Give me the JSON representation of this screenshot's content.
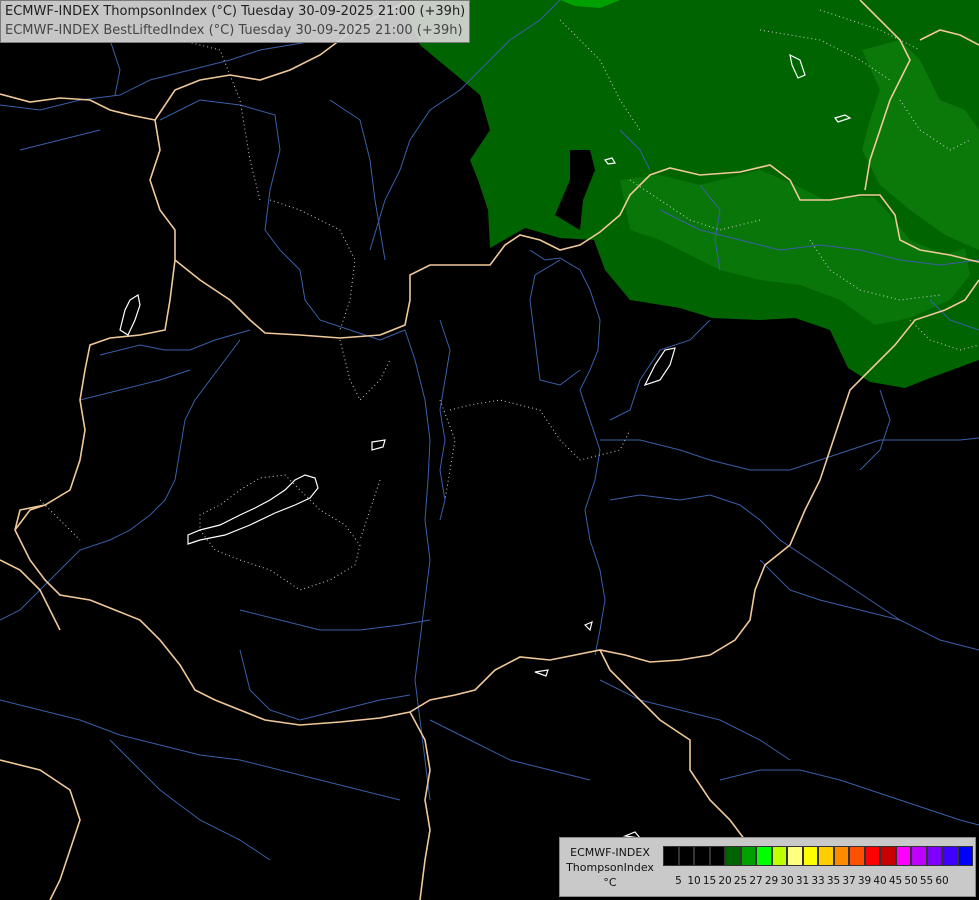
{
  "titles": {
    "line1": "ECMWF-INDEX ThompsonIndex (°C) Tuesday 30-09-2025 21:00 (+39h)",
    "line2": "ECMWF-INDEX BestLiftedIndex (°C) Tuesday 30-09-2025 21:00 (+39h)"
  },
  "legend": {
    "line1": "ECMWF-INDEX",
    "line2": "ThompsonIndex",
    "line3": "°C",
    "colors": [
      "#000000",
      "#000000",
      "#000000",
      "#000000",
      "#006400",
      "#00a000",
      "#00ff00",
      "#c0ff00",
      "#ffff80",
      "#ffff00",
      "#ffcc00",
      "#ff8c00",
      "#ff5000",
      "#ff0000",
      "#c80000",
      "#ff00ff",
      "#c000ff",
      "#8000ff",
      "#4000ff",
      "#0000ff"
    ],
    "ticks": [
      "5",
      "10",
      "15",
      "20",
      "25",
      "27",
      "29",
      "30",
      "31",
      "33",
      "35",
      "37",
      "39",
      "40",
      "45",
      "50",
      "55",
      "60"
    ]
  },
  "map": {
    "field_colors": {
      "background": "#000000",
      "green_area": "#006400",
      "light_green": "#1a8c1a"
    },
    "line_colors": {
      "borders": "#f5cfa0",
      "rivers": "#3b5fa8",
      "contours_dotted": "#d0d0d0",
      "lakes": "#ffffff"
    }
  }
}
